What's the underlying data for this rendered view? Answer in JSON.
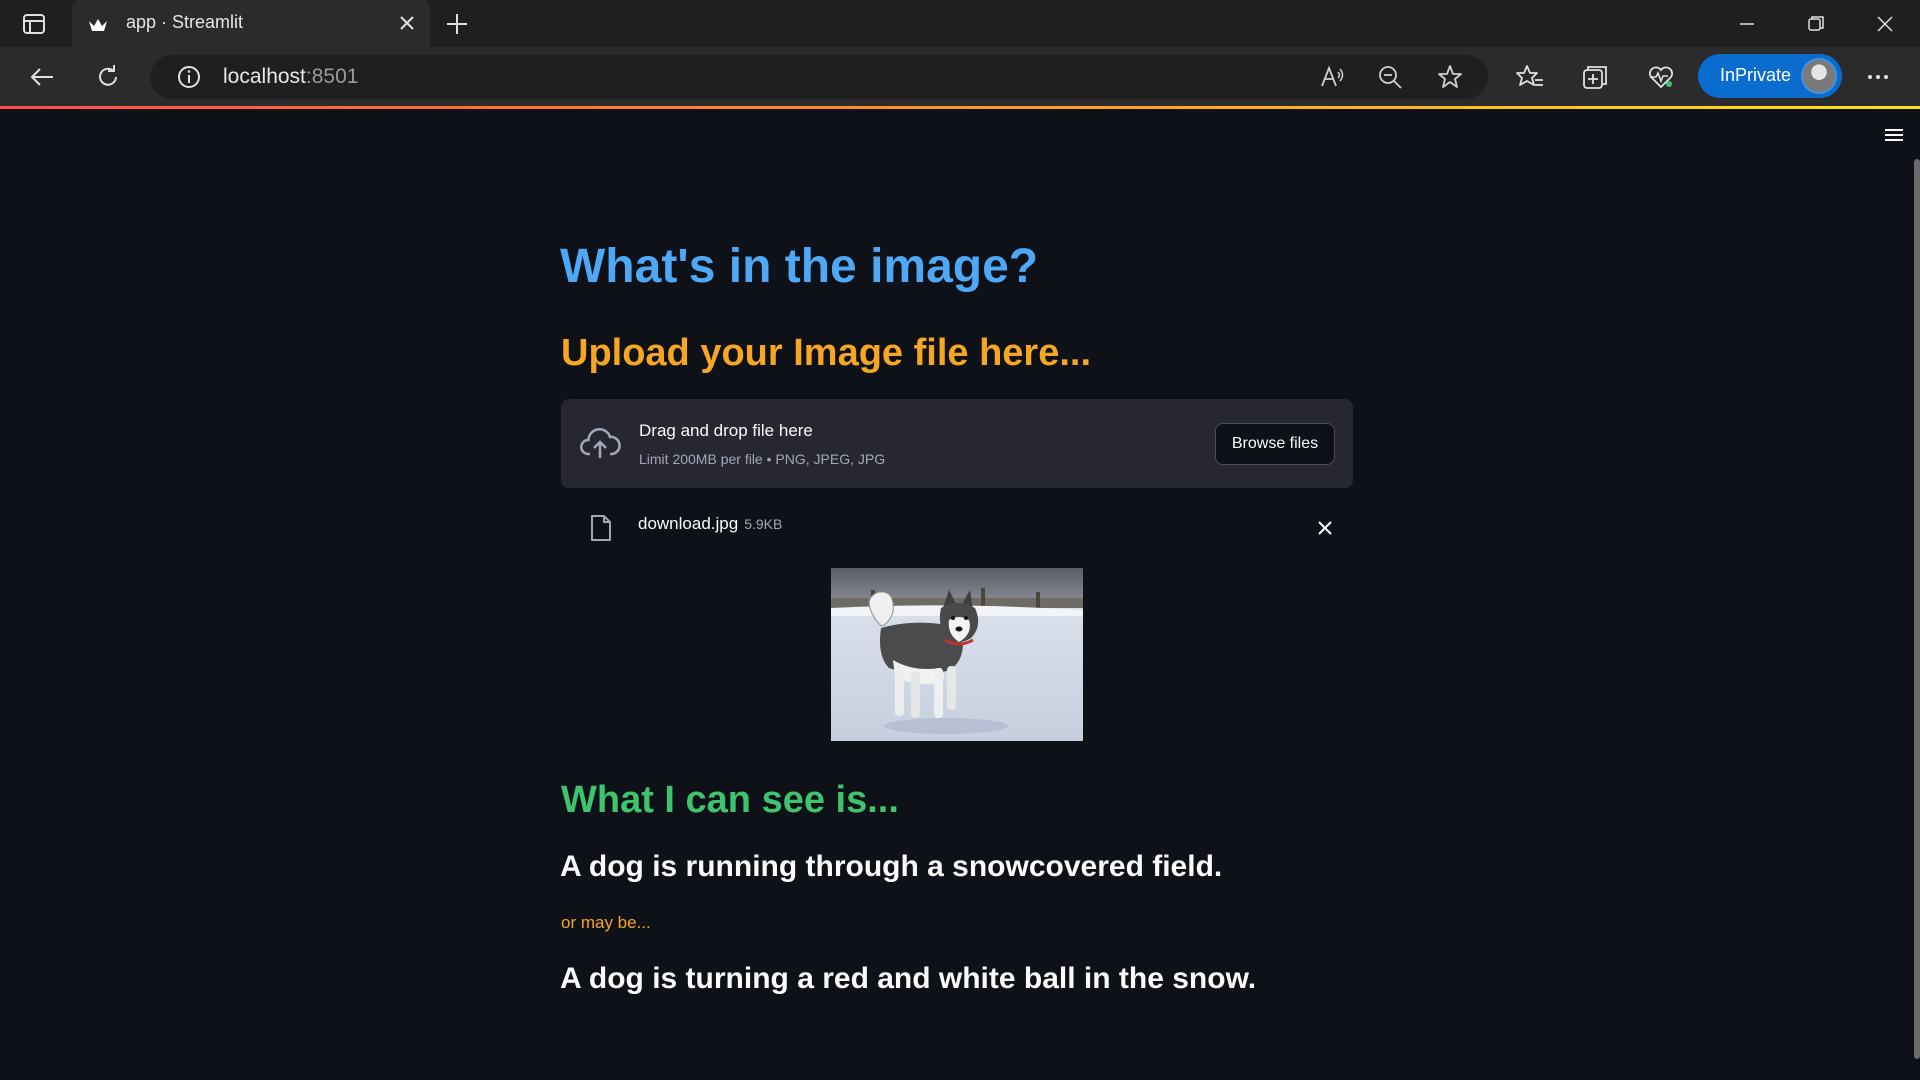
{
  "browser": {
    "tab": {
      "title": "app · Streamlit"
    },
    "address": {
      "host": "localhost",
      "port": ":8501"
    },
    "profile": {
      "label": "InPrivate"
    }
  },
  "app": {
    "title": "What's in the image?",
    "upload_header": "Upload your Image file here...",
    "uploader": {
      "drop_text": "Drag and drop file here",
      "limit_text": "Limit 200MB per file • PNG, JPEG, JPG",
      "browse_label": "Browse files"
    },
    "file": {
      "name": "download.jpg",
      "size": "5.9KB"
    },
    "result_header": "What I can see is...",
    "caption_primary": "A dog is running through a snowcovered field.",
    "alt_intro": "or may be...",
    "caption_secondary": "A dog is turning a red and white ball in the snow."
  },
  "colors": {
    "background": "#0e1117",
    "title_blue": "#4ea8f5",
    "header_orange": "#f5a623",
    "header_green": "#3ec46d",
    "inprivate_blue": "#0a6ccf"
  },
  "icons": [
    "tab-actions-icon",
    "streamlit-logo-icon",
    "close-icon",
    "plus-icon",
    "minimize-icon",
    "restore-icon",
    "back-icon",
    "refresh-icon",
    "info-icon",
    "read-aloud-icon",
    "zoom-out-icon",
    "favorite-star-icon",
    "favorites-icon",
    "collections-icon",
    "browser-essentials-icon",
    "more-icon",
    "hamburger-menu-icon",
    "cloud-upload-icon",
    "file-icon"
  ]
}
